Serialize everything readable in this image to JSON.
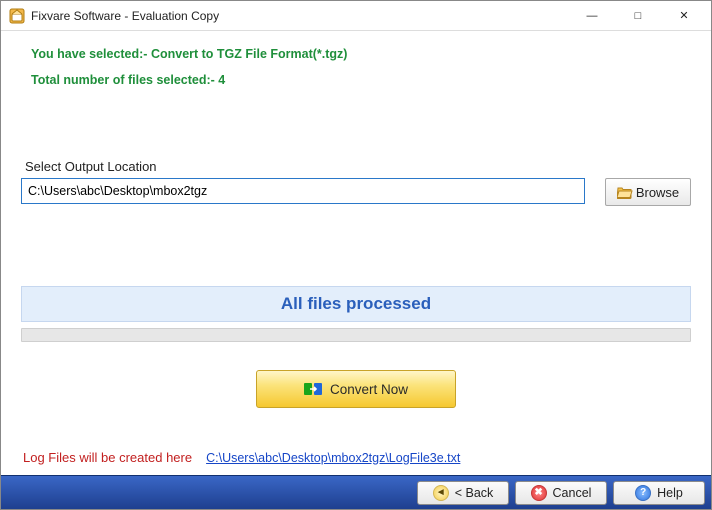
{
  "window": {
    "title": "Fixvare Software - Evaluation Copy"
  },
  "info": {
    "selected_line": "You have selected:- Convert to TGZ File Format(*.tgz)",
    "count_line": "Total number of files selected:- 4"
  },
  "output": {
    "label": "Select Output Location",
    "path": "C:\\Users\\abc\\Desktop\\mbox2tgz",
    "browse_label": "Browse"
  },
  "status": {
    "message": "All files processed"
  },
  "actions": {
    "convert_label": "Convert Now"
  },
  "log": {
    "prefix": "Log Files will be created here",
    "link": "C:\\Users\\abc\\Desktop\\mbox2tgz\\LogFile3e.txt"
  },
  "footer": {
    "back": "< Back",
    "cancel": "Cancel",
    "help": "Help"
  }
}
